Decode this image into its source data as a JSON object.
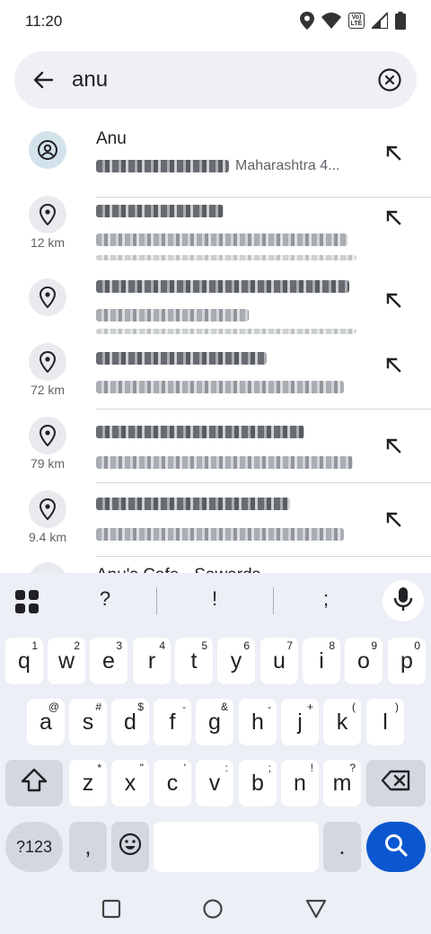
{
  "status_bar": {
    "time": "11:20",
    "icons": [
      "location-icon",
      "wifi-icon",
      "volte-icon",
      "signal-icon",
      "battery-icon"
    ],
    "volte_top": "Vo)",
    "volte_bottom": "LTE"
  },
  "search": {
    "query": "anu"
  },
  "suggestions": [
    {
      "kind": "contact",
      "title": "Anu",
      "subtitle_visible": "Maharashtra 4...",
      "distance": ""
    },
    {
      "kind": "place",
      "title": "",
      "subtitle_visible": "",
      "distance": "12 km"
    },
    {
      "kind": "place",
      "title": "",
      "subtitle_visible": "",
      "distance": ""
    },
    {
      "kind": "place",
      "title": "",
      "subtitle_visible": "",
      "distance": "72 km"
    },
    {
      "kind": "place",
      "title": "",
      "subtitle_visible": "",
      "distance": "79 km"
    },
    {
      "kind": "place",
      "title": "",
      "subtitle_visible": "",
      "distance": "9.4 km"
    }
  ],
  "peek_row": {
    "title": "Anu's Cafe - Sawards"
  },
  "keyboard": {
    "suggestions": [
      "?",
      "!",
      ";"
    ],
    "row1": [
      {
        "label": "q",
        "sup": "1"
      },
      {
        "label": "w",
        "sup": "2"
      },
      {
        "label": "e",
        "sup": "3"
      },
      {
        "label": "r",
        "sup": "4"
      },
      {
        "label": "t",
        "sup": "5"
      },
      {
        "label": "y",
        "sup": "6"
      },
      {
        "label": "u",
        "sup": "7"
      },
      {
        "label": "i",
        "sup": "8"
      },
      {
        "label": "o",
        "sup": "9"
      },
      {
        "label": "p",
        "sup": "0"
      }
    ],
    "row2": [
      {
        "label": "a",
        "sup": "@"
      },
      {
        "label": "s",
        "sup": "#"
      },
      {
        "label": "d",
        "sup": "$"
      },
      {
        "label": "f",
        "sup": "-"
      },
      {
        "label": "g",
        "sup": "&"
      },
      {
        "label": "h",
        "sup": "-"
      },
      {
        "label": "j",
        "sup": "+"
      },
      {
        "label": "k",
        "sup": "("
      },
      {
        "label": "l",
        "sup": ")"
      }
    ],
    "row3": [
      {
        "label": "z",
        "sup": "*"
      },
      {
        "label": "x",
        "sup": "\""
      },
      {
        "label": "c",
        "sup": "'"
      },
      {
        "label": "v",
        "sup": ":"
      },
      {
        "label": "b",
        "sup": ";"
      },
      {
        "label": "n",
        "sup": "!"
      },
      {
        "label": "m",
        "sup": "?"
      }
    ],
    "symbols_label": "?123",
    "comma_label": ",",
    "period_label": ".",
    "accent_color": "#0b57d0"
  },
  "nav_bar": {
    "buttons": [
      "recents-square-icon",
      "home-circle-icon",
      "back-triangle-icon"
    ]
  }
}
